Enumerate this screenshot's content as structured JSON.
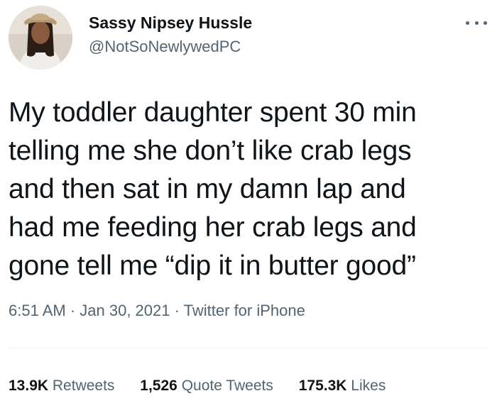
{
  "author": {
    "display_name": "Sassy Nipsey Hussle",
    "handle": "@NotSoNewlywedPC",
    "avatar_icon": "profile-photo"
  },
  "more_icon": "ellipsis-icon",
  "tweet": {
    "lines": [
      "My toddler daughter spent 30 min",
      "telling me she don’t like crab legs",
      "and then sat in my damn lap and",
      "had me feeding her crab legs and",
      "gone tell me “dip it in butter good”"
    ]
  },
  "meta": {
    "time": "6:51 AM",
    "separator": " · ",
    "date": "Jan 30, 2021",
    "source": "Twitter for iPhone"
  },
  "stats": {
    "retweets": {
      "count": "13.9K",
      "label": "Retweets"
    },
    "quote_tweets": {
      "count": "1,526",
      "label": "Quote Tweets"
    },
    "likes": {
      "count": "175.3K",
      "label": "Likes"
    }
  },
  "colors": {
    "text_primary": "#0f1419",
    "text_secondary": "#536471",
    "divider": "#eff3f4"
  }
}
